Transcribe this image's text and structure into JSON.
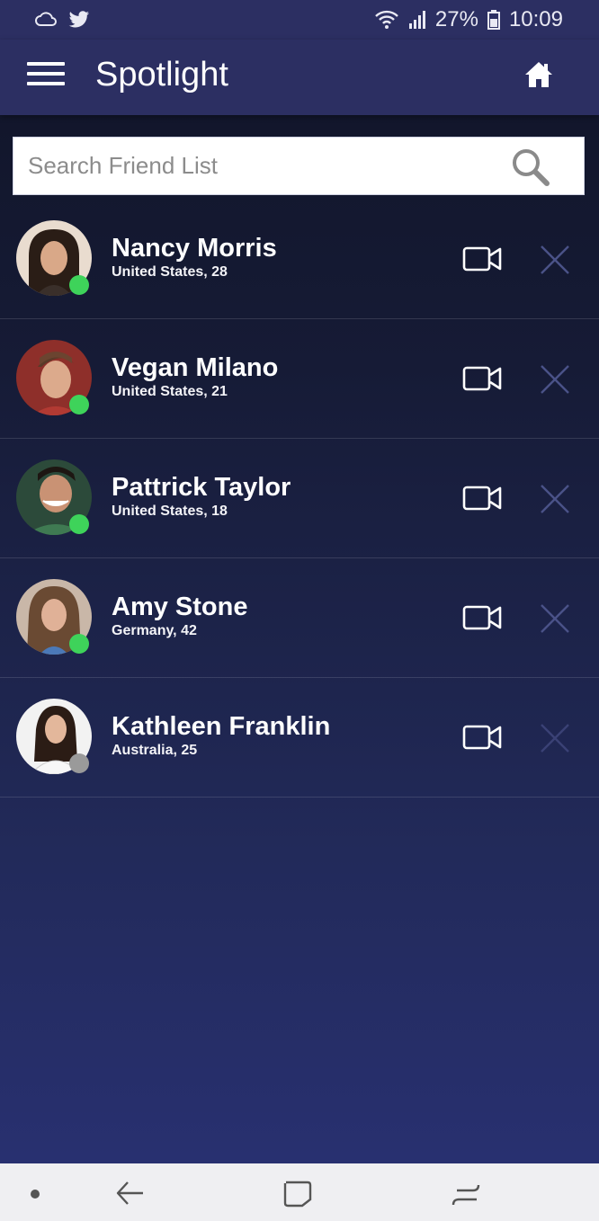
{
  "status_bar": {
    "battery": "27%",
    "time": "10:09"
  },
  "app_bar": {
    "title": "Spotlight"
  },
  "search": {
    "placeholder": "Search Friend List"
  },
  "colors": {
    "online": "#3ed35a",
    "offline": "#9a9a9a",
    "app_bar": "#2c2f62"
  },
  "friends": [
    {
      "name": "Nancy Morris",
      "location": "United States, 28",
      "status": "online"
    },
    {
      "name": "Vegan Milano",
      "location": "United States, 21",
      "status": "online"
    },
    {
      "name": "Pattrick Taylor",
      "location": "United States, 18",
      "status": "online"
    },
    {
      "name": "Amy Stone",
      "location": "Germany, 42",
      "status": "online"
    },
    {
      "name": "Kathleen Franklin",
      "location": "Australia, 25",
      "status": "offline"
    }
  ],
  "icons": {
    "menu": "menu-icon",
    "home": "home-icon",
    "search": "search-icon",
    "video": "video-camera-icon",
    "remove": "close-icon"
  }
}
